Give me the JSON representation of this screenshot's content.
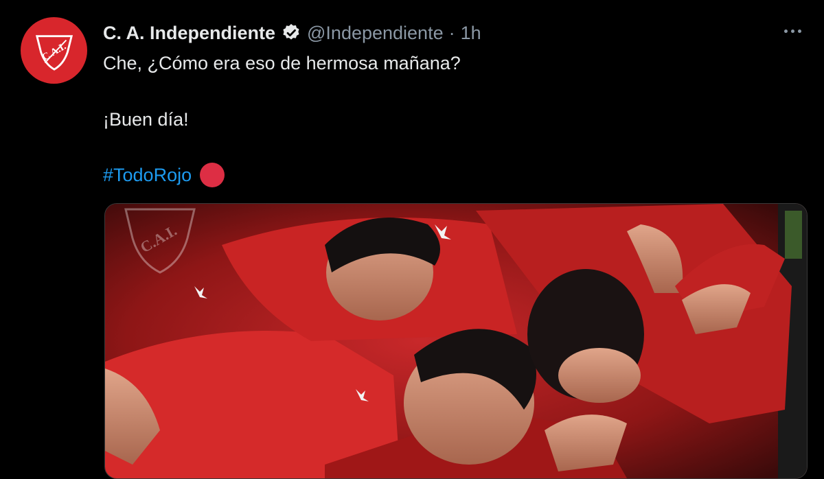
{
  "tweet": {
    "display_name": "C. A. Independiente",
    "handle": "@Independiente",
    "separator": "·",
    "time": "1h",
    "lines": [
      "Che, ¿Cómo era eso de hermosa mañana?",
      "¡Buen día!"
    ],
    "hashtag": "#TodoRojo",
    "avatar_text": "C.A.I.",
    "media_watermark": "C.A.I.",
    "media_alt": "players-celebrating-photo"
  },
  "colors": {
    "background": "#000000",
    "brand_red": "#d8262c",
    "link_blue": "#1d9bf0",
    "emoji_red": "#dd2e44",
    "secondary_text": "#8b98a5"
  },
  "icons": {
    "verified": "verified-badge-icon",
    "more": "more-horizontal-icon",
    "emoji": "red-circle-emoji"
  }
}
